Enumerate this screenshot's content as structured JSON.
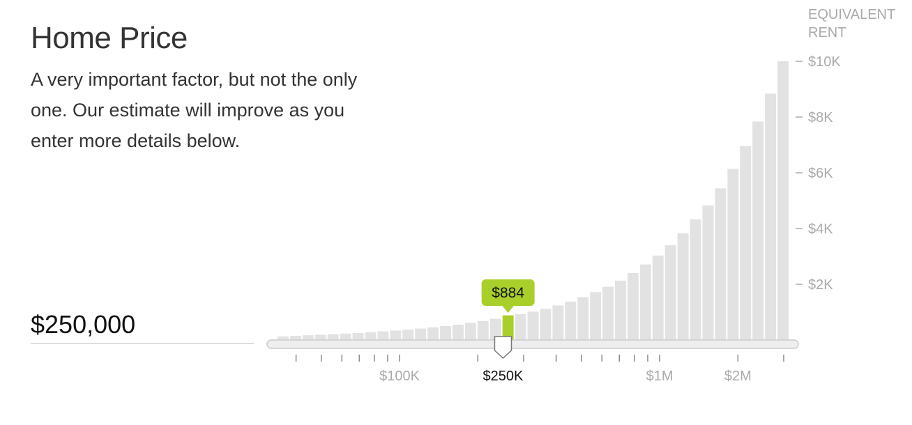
{
  "header": {
    "title": "Home Price",
    "description": "A very important factor, but not the only one. Our estimate will improve as you enter more details below."
  },
  "input": {
    "home_price_display": "$250,000"
  },
  "slider": {
    "selected_value": 250000,
    "selected_label": "$250K",
    "tooltip_text": "$884"
  },
  "colors": {
    "bar": "#e2e2e2",
    "highlight": "#a9cf2b",
    "axis_text": "#aaaaaa",
    "active_text": "#111111"
  },
  "chart_data": {
    "type": "bar",
    "title": "Home Price",
    "ylabel": "EQUIVALENT RENT",
    "x_scale": "log",
    "xlim": [
      35000,
      3000000
    ],
    "ylim": [
      0,
      10000
    ],
    "y_ticks": [
      {
        "value": 2000,
        "label": "$2K"
      },
      {
        "value": 4000,
        "label": "$4K"
      },
      {
        "value": 6000,
        "label": "$6K"
      },
      {
        "value": 8000,
        "label": "$8K"
      },
      {
        "value": 10000,
        "label": "$10K"
      }
    ],
    "x_tick_labels": [
      {
        "value": 100000,
        "label": "$100K"
      },
      {
        "value": 250000,
        "label": "$250K"
      },
      {
        "value": 1000000,
        "label": "$1M"
      },
      {
        "value": 2000000,
        "label": "$2M"
      }
    ],
    "x_minor_ticks": [
      40000,
      50000,
      60000,
      70000,
      80000,
      90000,
      100000,
      200000,
      300000,
      400000,
      500000,
      600000,
      700000,
      800000,
      900000,
      1000000,
      2000000,
      3000000
    ],
    "highlight_index": 18,
    "highlight_value": 884,
    "values": [
      130,
      150,
      170,
      190,
      210,
      230,
      250,
      280,
      310,
      340,
      370,
      410,
      450,
      500,
      550,
      610,
      680,
      760,
      884,
      930,
      1020,
      1120,
      1240,
      1380,
      1540,
      1720,
      1910,
      2130,
      2400,
      2710,
      3030,
      3400,
      3830,
      4330,
      4830,
      5440,
      6140,
      6960,
      7840,
      8840,
      10000
    ]
  }
}
